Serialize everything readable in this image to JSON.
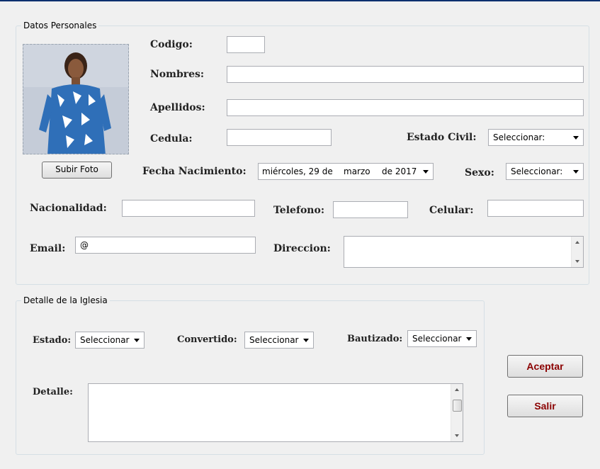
{
  "datos_personales": {
    "legend": "Datos Personales",
    "subir_foto": "Subir Foto",
    "codigo_label": "Codigo:",
    "codigo_value": "",
    "nombres_label": "Nombres:",
    "nombres_value": "",
    "apellidos_label": "Apellidos:",
    "apellidos_value": "",
    "cedula_label": "Cedula:",
    "cedula_value": "",
    "estado_civil_label": "Estado Civil:",
    "estado_civil_value": "Seleccionar:",
    "fecha_label": "Fecha Nacimiento:",
    "fecha_day": "miércoles, 29 de",
    "fecha_month": "marzo",
    "fecha_year": "de 2017",
    "sexo_label": "Sexo:",
    "sexo_value": "Seleccionar:",
    "nacionalidad_label": "Nacionalidad:",
    "nacionalidad_value": "",
    "telefono_label": "Telefono:",
    "telefono_value": "",
    "celular_label": "Celular:",
    "celular_value": "",
    "email_label": "Email:",
    "email_value": "@",
    "direccion_label": "Direccion:",
    "direccion_value": ""
  },
  "detalle_iglesia": {
    "legend": "Detalle de la Iglesia",
    "estado_label": "Estado:",
    "estado_value": "Seleccionar",
    "convertido_label": "Convertido:",
    "convertido_value": "Seleccionar",
    "bautizado_label": "Bautizado:",
    "bautizado_value": "Seleccionar",
    "detalle_label": "Detalle:",
    "detalle_value": ""
  },
  "actions": {
    "aceptar": "Aceptar",
    "salir": "Salir"
  },
  "colors": {
    "action_text": "#8b0000",
    "title_bar": "#0b2f6e"
  }
}
